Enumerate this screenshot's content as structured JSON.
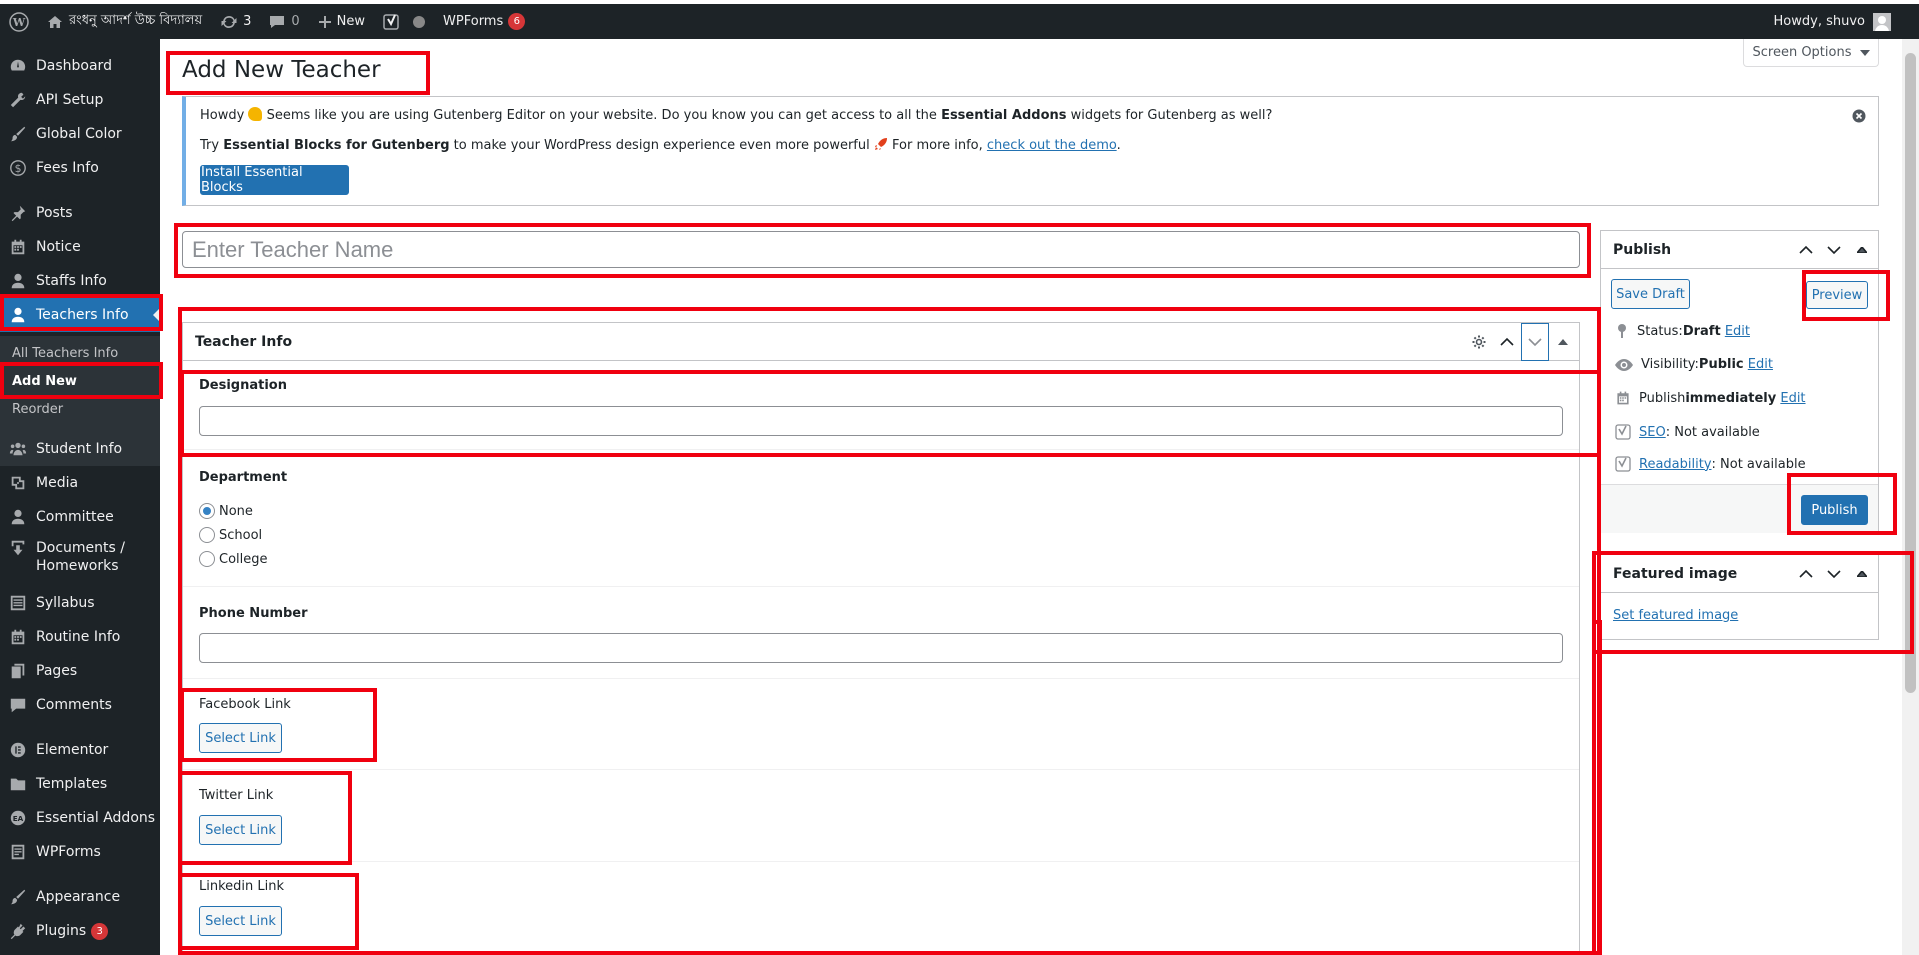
{
  "admin_bar": {
    "site_name": "রংধনু আদর্শ উচ্চ বিদ্যালয়",
    "updates_count": "3",
    "comments_count": "0",
    "new_label": "New",
    "wpforms_label": "WPForms",
    "wpforms_count": "6",
    "howdy": "Howdy, shuvo"
  },
  "sidebar": {
    "items": [
      {
        "label": "Dashboard",
        "icon": "dashboard-icon"
      },
      {
        "label": "API Setup",
        "icon": "wrench-icon"
      },
      {
        "label": "Global Color",
        "icon": "paintbrush-icon"
      },
      {
        "label": "Fees Info",
        "icon": "dollar-icon"
      },
      {
        "label": "Posts",
        "icon": "pin-icon"
      },
      {
        "label": "Notice",
        "icon": "calendar-icon"
      },
      {
        "label": "Staffs Info",
        "icon": "person-icon"
      },
      {
        "label": "Teachers Info",
        "icon": "person-icon"
      },
      {
        "label": "Student Info",
        "icon": "groups-icon"
      },
      {
        "label": "Media",
        "icon": "media-icon"
      },
      {
        "label": "Committee",
        "icon": "person-icon"
      },
      {
        "label": "Documents / Homeworks",
        "icon": "download-icon"
      },
      {
        "label": "Syllabus",
        "icon": "list-icon"
      },
      {
        "label": "Routine Info",
        "icon": "calendar-icon"
      },
      {
        "label": "Pages",
        "icon": "pages-icon"
      },
      {
        "label": "Comments",
        "icon": "comment-icon"
      },
      {
        "label": "Elementor",
        "icon": "elementor-icon"
      },
      {
        "label": "Templates",
        "icon": "folder-icon"
      },
      {
        "label": "Essential Addons",
        "icon": "ea-icon"
      },
      {
        "label": "WPForms",
        "icon": "form-icon"
      },
      {
        "label": "Appearance",
        "icon": "paintbrush-icon"
      },
      {
        "label": "Plugins",
        "icon": "plugin-icon",
        "badge": "3"
      }
    ],
    "submenu": [
      "All Teachers Info",
      "Add New",
      "Reorder"
    ]
  },
  "screen_options": "Screen Options",
  "page_title": "Add New Teacher",
  "notice": {
    "line1_a": "Howdy ",
    "line1_b": " Seems like you are using Gutenberg Editor on your website. Do you know you can get access to all the ",
    "line1_bold": "Essential Addons",
    "line1_c": " widgets for Gutenberg as well?",
    "line2_a": "Try ",
    "line2_bold": "Essential Blocks for Gutenberg",
    "line2_b": " to make your WordPress design experience even more powerful ",
    "line2_c": " For more info, ",
    "line2_link": "check out the demo",
    "line2_d": ".",
    "button": "Install Essential Blocks"
  },
  "title_placeholder": "Enter Teacher Name",
  "teacher_info": {
    "title": "Teacher Info",
    "designation_label": "Designation",
    "department_label": "Department",
    "departments": [
      "None",
      "School",
      "College"
    ],
    "selected_department": "None",
    "phone_label": "Phone Number",
    "facebook_label": "Facebook Link",
    "twitter_label": "Twitter Link",
    "linkedin_label": "Linkedin Link",
    "select_link": "Select Link"
  },
  "publish": {
    "title": "Publish",
    "save_draft": "Save Draft",
    "preview": "Preview",
    "status_label": "Status: ",
    "status_value": "Draft",
    "visibility_label": "Visibility: ",
    "visibility_value": "Public",
    "publish_label": "Publish ",
    "publish_value": "immediately",
    "edit": "Edit",
    "seo_link": "SEO",
    "seo_value": ": Not available",
    "readability_link": "Readability",
    "readability_value": ": Not available",
    "publish_button": "Publish"
  },
  "featured_image": {
    "title": "Featured image",
    "link": "Set featured image"
  },
  "colors": {
    "admin_bar": "#1d2327",
    "accent": "#2271b1",
    "highlight_box": "#f0000f",
    "badge": "#d63638"
  }
}
